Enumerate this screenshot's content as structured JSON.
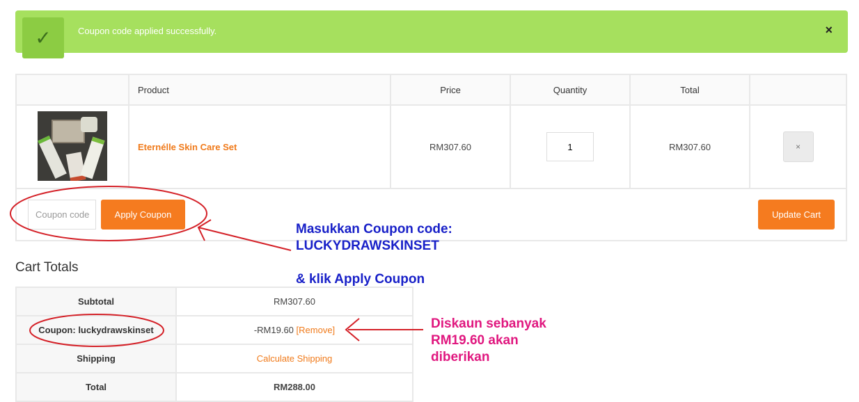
{
  "notice": {
    "message": "Coupon code applied successfully.",
    "check_icon": "check-icon",
    "close_glyph": "×"
  },
  "cart": {
    "headers": [
      "",
      "Product",
      "Price",
      "Quantity",
      "Total",
      ""
    ],
    "item": {
      "name": "Eternélle Skin Care Set",
      "price": "RM307.60",
      "quantity": "1",
      "total": "RM307.60",
      "remove_glyph": "×"
    }
  },
  "actions": {
    "coupon_placeholder": "Coupon code",
    "apply_label": "Apply Coupon",
    "update_label": "Update Cart"
  },
  "totals": {
    "title": "Cart Totals",
    "rows": [
      {
        "label": "Subtotal",
        "value": "RM307.60"
      },
      {
        "label": "Coupon: luckydrawskinset",
        "value": "-RM19.60",
        "link": "[Remove]"
      },
      {
        "label": "Shipping",
        "value": "Calculate Shipping"
      },
      {
        "label": "Total",
        "value": "RM288.00"
      }
    ]
  },
  "annotations": {
    "coupon_instruction_line1": "Masukkan Coupon code:",
    "coupon_instruction_line2": "LUCKYDRAWSKINSET",
    "coupon_instruction_line3": "& klik Apply Coupon",
    "discount_line1": "Diskaun sebanyak",
    "discount_line2": "RM19.60 akan",
    "discount_line3": "diberikan"
  },
  "colors": {
    "notice_bg": "#a6e05e",
    "accent_orange": "#f57b1f",
    "annotation_blue": "#1820c8",
    "annotation_pink": "#e0177f",
    "annotation_red": "#d42027"
  }
}
